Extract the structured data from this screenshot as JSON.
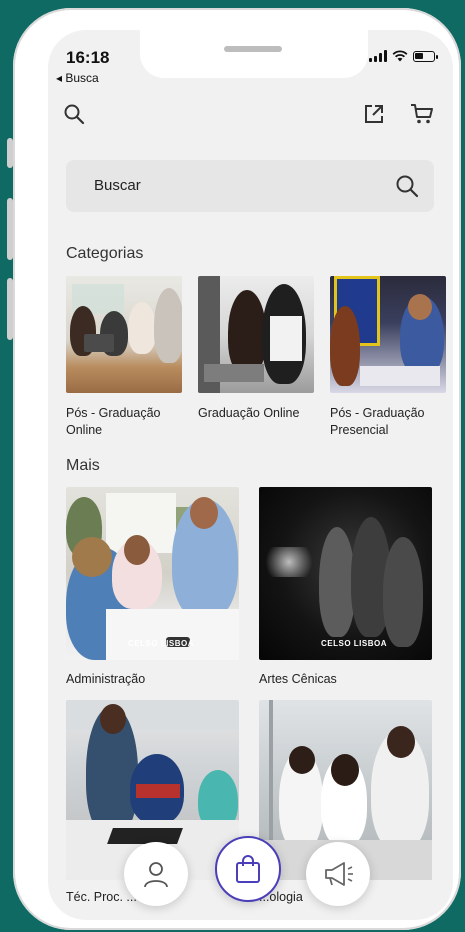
{
  "status": {
    "time": "16:18",
    "back_label": "◂ Busca"
  },
  "header": {
    "search_icon": "search-icon",
    "share_icon": "external-link-icon",
    "cart_icon": "cart-icon"
  },
  "search": {
    "placeholder": "Buscar"
  },
  "sections": {
    "categories_title": "Categorias",
    "more_title": "Mais"
  },
  "categories": [
    {
      "label": "Pós - Graduação Online"
    },
    {
      "label": "Graduação Online"
    },
    {
      "label": "Pós - Graduação Presencial"
    }
  ],
  "more": [
    {
      "label": "Administração",
      "watermark": "CELSO LISBOA"
    },
    {
      "label": "Artes Cênicas",
      "watermark": "CELSO LISBOA"
    },
    {
      "label": "Téc. Proc. ... as"
    },
    {
      "label": "...ologia"
    }
  ],
  "bottom_nav": [
    {
      "icon": "user-icon"
    },
    {
      "icon": "shopping-bag-icon"
    },
    {
      "icon": "megaphone-icon"
    }
  ],
  "colors": {
    "background": "#0f6a63",
    "screen": "#f1f1f1",
    "accent": "#4a3fb8"
  }
}
